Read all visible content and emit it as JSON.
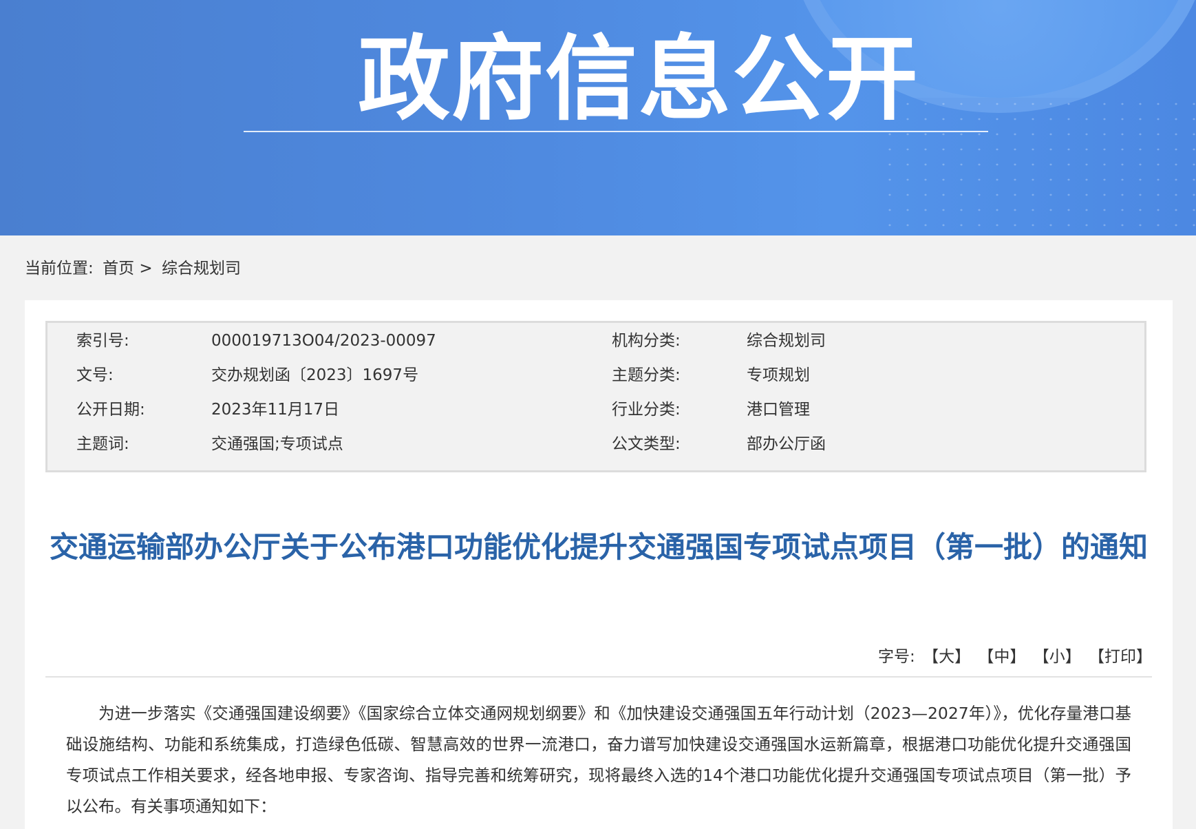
{
  "banner": {
    "title": "政府信息公开"
  },
  "breadcrumb": {
    "prefix": "当前位置:",
    "home": "首页",
    "separator": ">",
    "current": "综合规划司"
  },
  "meta": {
    "index_label": "索引号:",
    "index_value": "000019713O04/2023-00097",
    "org_label": "机构分类:",
    "org_value": "综合规划司",
    "docno_label": "文号:",
    "docno_value": "交办规划函〔2023〕1697号",
    "topic_label": "主题分类:",
    "topic_value": "专项规划",
    "date_label": "公开日期:",
    "date_value": "2023年11月17日",
    "industry_label": "行业分类:",
    "industry_value": "港口管理",
    "keywords_label": "主题词:",
    "keywords_value": "交通强国;专项试点",
    "doctype_label": "公文类型:",
    "doctype_value": "部办公厅函"
  },
  "document": {
    "title": "交通运输部办公厅关于公布港口功能优化提升交通强国专项试点项目（第一批）的通知",
    "body": "为进一步落实《交通强国建设纲要》《国家综合立体交通网规划纲要》和《加快建设交通强国五年行动计划（2023—2027年）》，优化存量港口基础设施结构、功能和系统集成，打造绿色低碳、智慧高效的世界一流港口，奋力谱写加快建设交通强国水运新篇章，根据港口功能优化提升交通强国专项试点工作相关要求，经各地申报、专家咨询、指导完善和统筹研究，现将最终入选的14个港口功能优化提升交通强国专项试点项目（第一批）予以公布。有关事项通知如下："
  },
  "font_tools": {
    "label": "字号:",
    "large": "【大】",
    "medium": "【中】",
    "small": "【小】",
    "print": "【打印】"
  },
  "colors": {
    "banner": "#4f8ae0",
    "title": "#2a63a8"
  }
}
